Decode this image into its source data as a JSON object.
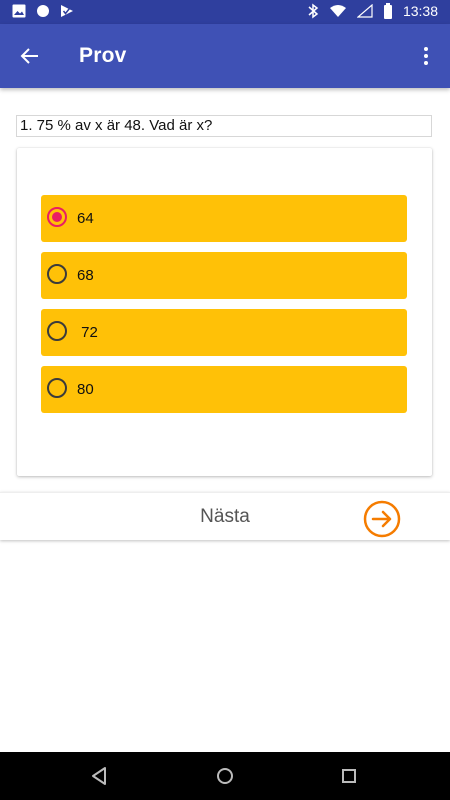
{
  "status": {
    "time": "13:38",
    "left_icons": [
      "image-icon",
      "circle-icon",
      "play-check-icon"
    ],
    "right_icons": [
      "bluetooth-icon",
      "wifi-icon",
      "signal-icon",
      "battery-icon"
    ]
  },
  "app_bar": {
    "title": "Prov",
    "back_icon": "arrow-back-icon",
    "menu_icon": "more-vert-icon",
    "color": "#3f51b5"
  },
  "question": {
    "text": "1. 75 % av x är 48. Vad är x?"
  },
  "options": [
    {
      "label": "64",
      "selected": true
    },
    {
      "label": "68",
      "selected": false
    },
    {
      "label": " 72",
      "selected": false
    },
    {
      "label": "80",
      "selected": false
    }
  ],
  "option_color": "#ffc107",
  "selected_color": "#e91e63",
  "next": {
    "label": "Nästa",
    "icon": "arrow-forward-circle-icon",
    "icon_color": "#f57c00"
  },
  "nav": {
    "items": [
      "back-triangle-icon",
      "home-circle-icon",
      "recents-square-icon"
    ]
  }
}
